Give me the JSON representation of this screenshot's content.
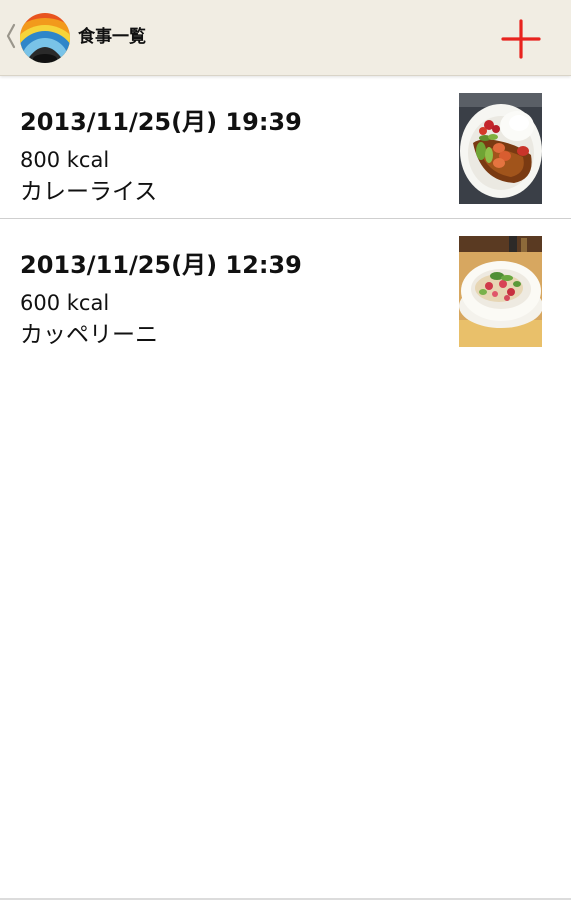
{
  "action_bar": {
    "title": "食事一覧",
    "up_icon": "chevron-left-icon",
    "logo_icon": "sunrise-logo-icon",
    "add_icon": "plus-icon",
    "accent_color": "#e8231e",
    "background_color": "#f1ede3"
  },
  "meals": [
    {
      "datetime": "2013/11/25(月) 19:39",
      "kcal": "800 kcal",
      "name": "カレーライス",
      "photo_icon": "curry-plate-photo"
    },
    {
      "datetime": "2013/11/25(月) 12:39",
      "kcal": "600 kcal",
      "name": "カッペリーニ",
      "photo_icon": "pasta-plate-photo"
    }
  ]
}
